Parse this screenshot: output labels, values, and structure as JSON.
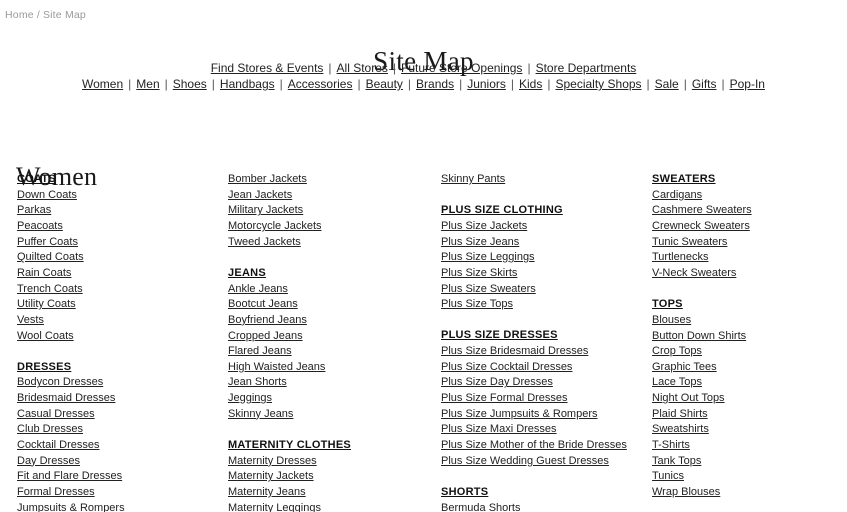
{
  "breadcrumb": {
    "home": "Home",
    "separator": "/",
    "current": "Site Map"
  },
  "page_title": "Site Map",
  "nav_primary": [
    "Find Stores & Events",
    "All Stores",
    "Future Store Openings",
    "Store Departments"
  ],
  "nav_secondary": [
    "Women",
    "Men",
    "Shoes",
    "Handbags",
    "Accessories",
    "Beauty",
    "Brands",
    "Juniors",
    "Kids",
    "Specialty Shops",
    "Sale",
    "Gifts",
    "Pop-In"
  ],
  "nav_divider": "|",
  "section_heading": "Women",
  "columns": [
    {
      "groups": [
        {
          "header": "COATS",
          "items": [
            "Down Coats",
            "Parkas",
            "Peacoats",
            "Puffer Coats",
            "Quilted Coats",
            "Rain Coats",
            "Trench Coats",
            "Utility Coats",
            "Vests",
            "Wool Coats"
          ]
        },
        {
          "header": "DRESSES",
          "items": [
            "Bodycon Dresses",
            "Bridesmaid Dresses",
            "Casual Dresses",
            "Club Dresses",
            "Cocktail Dresses",
            "Day Dresses",
            "Fit and Flare Dresses",
            "Formal Dresses",
            "Jumpsuits & Rompers"
          ]
        }
      ]
    },
    {
      "groups": [
        {
          "header": "",
          "items": [
            "Bomber Jackets",
            "Jean Jackets",
            "Military Jackets",
            "Motorcycle Jackets",
            "Tweed Jackets"
          ]
        },
        {
          "header": "JEANS",
          "items": [
            "Ankle Jeans",
            "Bootcut Jeans",
            "Boyfriend Jeans",
            "Cropped Jeans",
            "Flared Jeans",
            "High Waisted Jeans",
            "Jean Shorts",
            "Jeggings",
            "Skinny Jeans"
          ]
        },
        {
          "header": "MATERNITY CLOTHES",
          "items": [
            "Maternity Dresses",
            "Maternity Jackets",
            "Maternity Jeans",
            "Maternity Leggings"
          ]
        }
      ]
    },
    {
      "groups": [
        {
          "header": "",
          "items": [
            "Skinny Pants"
          ]
        },
        {
          "header": "PLUS SIZE CLOTHING",
          "items": [
            "Plus Size Jackets",
            "Plus Size Jeans",
            "Plus Size Leggings",
            "Plus Size Skirts",
            "Plus Size Sweaters",
            "Plus Size Tops"
          ]
        },
        {
          "header": "PLUS SIZE DRESSES",
          "items": [
            "Plus Size Bridesmaid Dresses",
            "Plus Size Cocktail Dresses",
            "Plus Size Day Dresses",
            "Plus Size Formal Dresses",
            "Plus Size Jumpsuits & Rompers",
            "Plus Size Maxi Dresses",
            "Plus Size Mother of the Bride Dresses",
            "Plus Size Wedding Guest Dresses"
          ]
        },
        {
          "header": "SHORTS",
          "items": [
            "Bermuda Shorts"
          ]
        }
      ]
    },
    {
      "groups": [
        {
          "header": "SWEATERS",
          "items": [
            "Cardigans",
            "Cashmere Sweaters",
            "Crewneck Sweaters",
            "Tunic Sweaters",
            "Turtlenecks",
            "V-Neck Sweaters"
          ]
        },
        {
          "header": "TOPS",
          "items": [
            "Blouses",
            "Button Down Shirts",
            "Crop Tops",
            "Graphic Tees",
            "Lace Tops",
            "Night Out Tops",
            "Plaid Shirts",
            "Sweatshirts",
            "T-Shirts",
            "Tank Tops",
            "Tunics",
            "Wrap Blouses"
          ]
        }
      ]
    }
  ]
}
